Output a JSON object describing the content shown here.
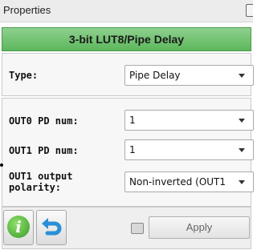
{
  "titlebar": {
    "title": "Properties"
  },
  "block": {
    "name": "3-bit LUT8/Pipe Delay"
  },
  "type_section": {
    "type_label": "Type:",
    "type_value": "Pipe Delay"
  },
  "params": {
    "out0_label": "OUT0 PD num:",
    "out0_value": "1",
    "out1_label": "OUT1 PD num:",
    "out1_value": "1",
    "polarity_label_line1": "OUT1 output",
    "polarity_label_line2": "polarity:",
    "polarity_value": "Non-inverted (OUT1"
  },
  "footer": {
    "info_glyph": "i",
    "info_icon": "info-icon",
    "undo_icon": "undo-arrow-icon",
    "apply_label": "Apply",
    "accent_color": "#5cb85c",
    "undo_color": "#2a8fd8"
  }
}
